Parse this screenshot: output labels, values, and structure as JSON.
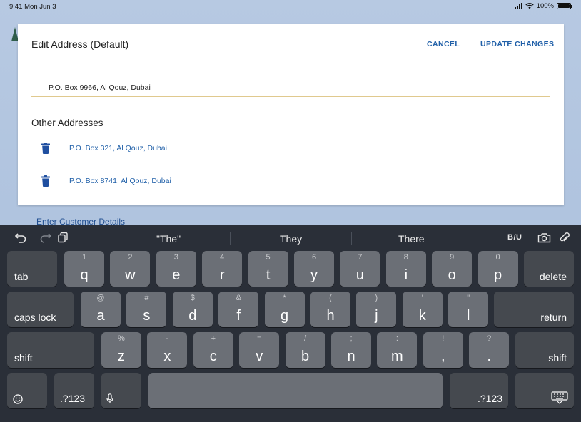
{
  "status": {
    "time": "9:41  Mon Jun 3",
    "battery": "100%"
  },
  "background": {
    "hint": "Enter Customer Details"
  },
  "modal": {
    "title": "Edit Address (Default)",
    "cancel_label": "CANCEL",
    "update_label": "UPDATE CHANGES",
    "address_value": "P.O. Box 9966, Al Qouz, Dubai",
    "other_title": "Other Addresses",
    "other_addresses": [
      "P.O. Box 321, Al Qouz, Dubai",
      "P.O. Box 8741, Al Qouz, Dubai"
    ]
  },
  "keyboard": {
    "suggestions": [
      "\"The\"",
      "They",
      "There"
    ],
    "format_label": "B/U",
    "row1": [
      {
        "sub": "1",
        "main": "q"
      },
      {
        "sub": "2",
        "main": "w"
      },
      {
        "sub": "3",
        "main": "e"
      },
      {
        "sub": "4",
        "main": "r"
      },
      {
        "sub": "5",
        "main": "t"
      },
      {
        "sub": "6",
        "main": "y"
      },
      {
        "sub": "7",
        "main": "u"
      },
      {
        "sub": "8",
        "main": "i"
      },
      {
        "sub": "9",
        "main": "o"
      },
      {
        "sub": "0",
        "main": "p"
      }
    ],
    "row2": [
      {
        "sub": "@",
        "main": "a"
      },
      {
        "sub": "#",
        "main": "s"
      },
      {
        "sub": "$",
        "main": "d"
      },
      {
        "sub": "&",
        "main": "f"
      },
      {
        "sub": "*",
        "main": "g"
      },
      {
        "sub": "(",
        "main": "h"
      },
      {
        "sub": ")",
        "main": "j"
      },
      {
        "sub": "'",
        "main": "k"
      },
      {
        "sub": "\"",
        "main": "l"
      }
    ],
    "row3": [
      {
        "sub": "%",
        "main": "z"
      },
      {
        "sub": "-",
        "main": "x"
      },
      {
        "sub": "+",
        "main": "c"
      },
      {
        "sub": "=",
        "main": "v"
      },
      {
        "sub": "/",
        "main": "b"
      },
      {
        "sub": ";",
        "main": "n"
      },
      {
        "sub": ":",
        "main": "m"
      },
      {
        "sub": "!",
        "main": ","
      },
      {
        "sub": "?",
        "main": "."
      }
    ],
    "labels": {
      "tab": "tab",
      "delete": "delete",
      "caps_lock": "caps lock",
      "return": "return",
      "shift_left": "shift",
      "shift_right": "shift",
      "num_left": ".?123",
      "num_right": ".?123"
    },
    "icons": {
      "undo": "undo-icon",
      "redo": "redo-icon",
      "paste": "paste-icon",
      "camera": "camera-icon",
      "attach": "paperclip-icon",
      "emoji": "emoji-icon",
      "mic": "microphone-icon",
      "hide": "keyboard-hide-icon"
    }
  }
}
